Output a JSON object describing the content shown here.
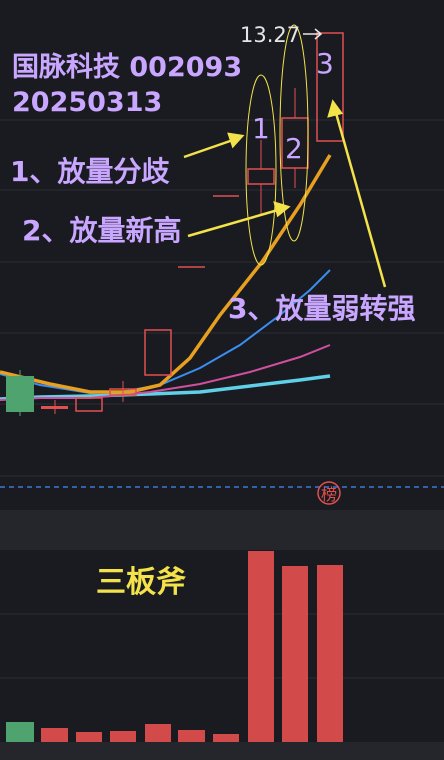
{
  "stock": {
    "name_code": "国脉科技 002093",
    "date": "20250313"
  },
  "price_marker": "13.27",
  "badge": "榜",
  "annotations": {
    "a1": "1、放量分歧",
    "a2": "2、放量新高",
    "a3": "3、放量弱转强",
    "n1": "1",
    "n2": "2",
    "n3": "3"
  },
  "volume_label": "三板斧",
  "colors": {
    "up": "#e05050",
    "down": "#4fa36f",
    "orange_ma": "#e7a020",
    "blue_ma": "#3a8ef0",
    "pink_ma": "#d04fa0",
    "cyan_ma": "#5fd0e8",
    "annotation_text": "#c9a6ff",
    "arrow": "#f3e24a",
    "dashed_line": "#3a7bd5"
  }
}
